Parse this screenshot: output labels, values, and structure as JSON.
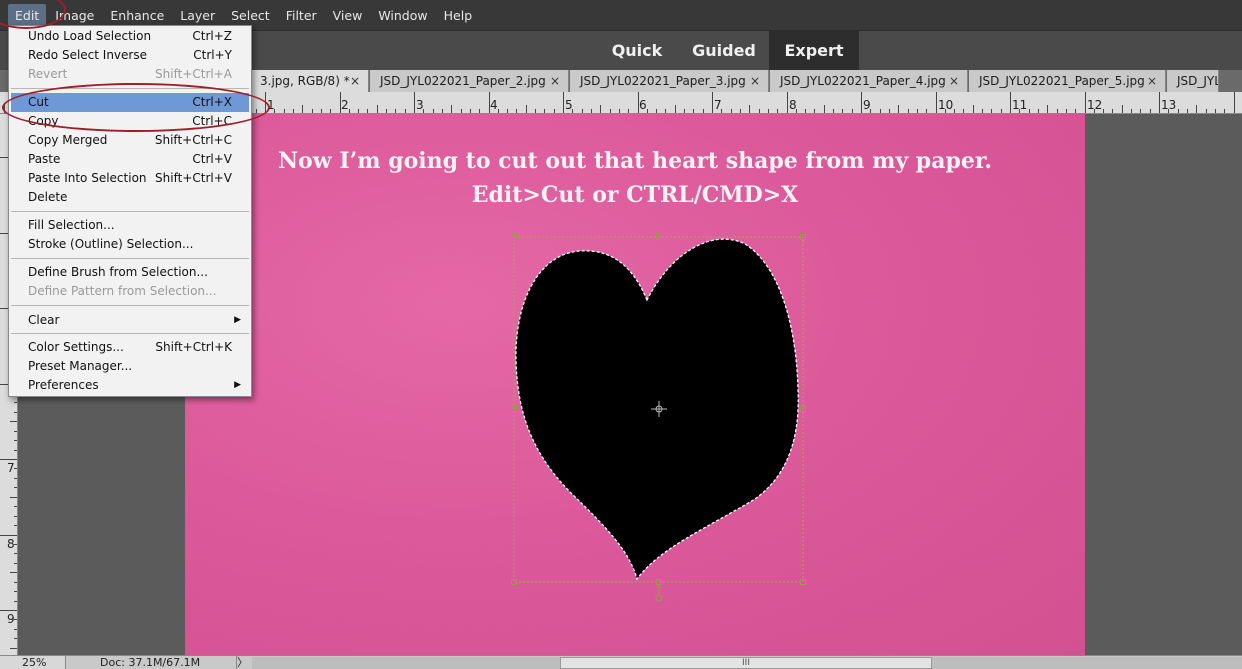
{
  "menubar": {
    "items": [
      "Edit",
      "Image",
      "Enhance",
      "Layer",
      "Select",
      "Filter",
      "View",
      "Window",
      "Help"
    ]
  },
  "modes": {
    "quick": "Quick",
    "guided": "Guided",
    "expert": "Expert"
  },
  "tabs": [
    {
      "label": "3.jpg, RGB/8) *",
      "close": "×"
    },
    {
      "label": "JSD_JYL022021_Paper_2.jpg",
      "close": "×"
    },
    {
      "label": "JSD_JYL022021_Paper_3.jpg",
      "close": "×"
    },
    {
      "label": "JSD_JYL022021_Paper_4.jpg",
      "close": "×"
    },
    {
      "label": "JSD_JYL022021_Paper_5.jpg",
      "close": "×"
    },
    {
      "label": "JSD_JYL",
      "close": ""
    }
  ],
  "ruler": {
    "h_labels": [
      "1",
      "2",
      "3",
      "4",
      "5",
      "6",
      "7",
      "8",
      "9",
      "10",
      "11",
      "12",
      "13"
    ],
    "v_labels": [
      "7",
      "8",
      "9"
    ]
  },
  "canvas": {
    "line1": "Now I’m going to cut out that heart shape from my paper.",
    "line2": "Edit>Cut or CTRL/CMD>X",
    "paper_color": "#de5a9a",
    "heart_color": "#000000"
  },
  "edit_menu": {
    "items": [
      {
        "label": "Undo Load Selection",
        "shortcut": "Ctrl+Z"
      },
      {
        "label": "Redo Select Inverse",
        "shortcut": "Ctrl+Y"
      },
      {
        "label": "Revert",
        "shortcut": "Shift+Ctrl+A"
      },
      {
        "label": "Cut",
        "shortcut": "Ctrl+X"
      },
      {
        "label": "Copy",
        "shortcut": "Ctrl+C"
      },
      {
        "label": "Copy Merged",
        "shortcut": "Shift+Ctrl+C"
      },
      {
        "label": "Paste",
        "shortcut": "Ctrl+V"
      },
      {
        "label": "Paste Into Selection",
        "shortcut": "Shift+Ctrl+V"
      },
      {
        "label": "Delete",
        "shortcut": ""
      },
      {
        "label": "Fill Selection...",
        "shortcut": ""
      },
      {
        "label": "Stroke (Outline) Selection...",
        "shortcut": ""
      },
      {
        "label": "Define Brush from Selection...",
        "shortcut": ""
      },
      {
        "label": "Define Pattern from Selection...",
        "shortcut": ""
      },
      {
        "label": "Clear",
        "shortcut": ""
      },
      {
        "label": "Color Settings...",
        "shortcut": "Shift+Ctrl+K"
      },
      {
        "label": "Preset Manager...",
        "shortcut": ""
      },
      {
        "label": "Preferences",
        "shortcut": ""
      }
    ]
  },
  "status": {
    "zoom": "25%",
    "doc": "Doc: 37.1M/67.1M",
    "arrow": "〉",
    "grip": "III"
  },
  "colors": {
    "highlight": "#6e98d6",
    "annotation": "#9c1f2a",
    "menubar": "#383838"
  }
}
